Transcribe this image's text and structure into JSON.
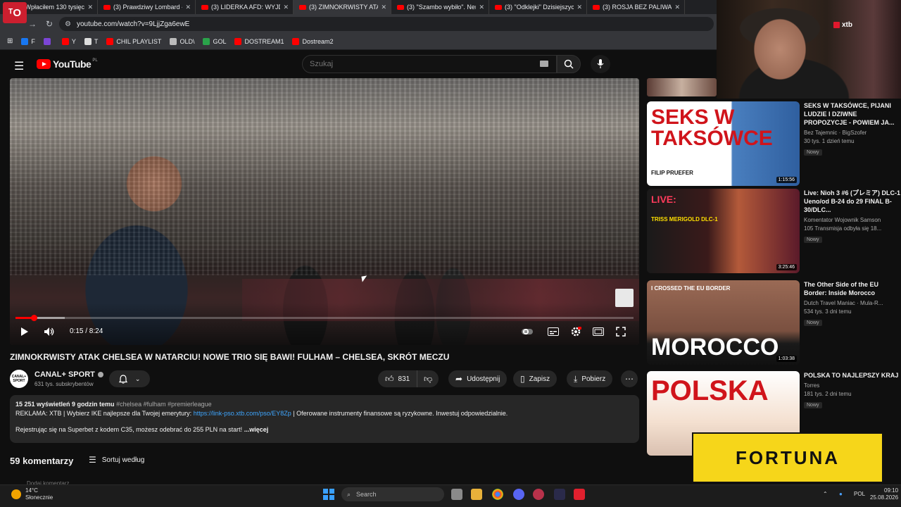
{
  "browser": {
    "tabs": [
      {
        "title": "(3) Wpłaciłem 130 tysięcy",
        "active": false
      },
      {
        "title": "(3) Prawdziwy Lombard -",
        "active": false
      },
      {
        "title": "(3) LIDERKA AFD: WYJDZIE",
        "active": false
      },
      {
        "title": "(3) ZIMNOKRWISTY ATAK",
        "active": true
      },
      {
        "title": "(3) \"Szambo wybiło\". Ner",
        "active": false
      },
      {
        "title": "(3) \"Odklejki\" Dzisiejszych",
        "active": false
      },
      {
        "title": "(3) ROSJA BEZ PALIWA, P",
        "active": false
      }
    ],
    "url": "youtube.com/watch?v=9LjjZga6ewE",
    "bookmarks": [
      {
        "label": "F",
        "color": "#1877f2"
      },
      {
        "label": "",
        "color": "#7b45d6"
      },
      {
        "label": "Y",
        "color": "#ff0000"
      },
      {
        "label": "T",
        "color": "#dddddd"
      },
      {
        "label": "CHIL PLAYLIST",
        "color": "#ff0000"
      },
      {
        "label": "OLD\\",
        "color": "#bbbbbb"
      },
      {
        "label": "GOL",
        "color": "#2aa34a"
      },
      {
        "label": "DOSTREAM1",
        "color": "#ff0000"
      },
      {
        "label": "Dostream2",
        "color": "#ff0000"
      }
    ],
    "favicon_text": "ᵀO"
  },
  "youtube": {
    "logo_text": "YouTube",
    "region": "PL",
    "search_placeholder": "Szukaj"
  },
  "player": {
    "current_time": "0:15",
    "duration": "8:24",
    "time_display": "0:15 / 8:24",
    "progress_fraction": 0.0298,
    "buffer_fraction": 0.08
  },
  "video": {
    "title": "ZIMNOKRWISTY ATAK CHELSEA W NATARCIU! NOWE TRIO SIĘ BAWI! FULHAM – CHELSEA, SKRÓT MECZU",
    "channel": "CANAL+ SPORT",
    "channel_avatar_text": "CANAL+ SPORT",
    "subscribers": "631 tys. subskrybentów",
    "likes": "831",
    "share_label": "Udostępnij",
    "save_label": "Zapisz",
    "download_label": "Pobierz"
  },
  "description": {
    "views_time": "15 251 wyświetleń  9 godzin temu",
    "hashtags": "#chelsea #fulham #premierleague",
    "ad_prefix": "REKLAMA: XTB | Wybierz IKE najlepsze dla Twojej emerytury: ",
    "ad_link": "https://link-pso.xtb.com/pso/EY8Zp",
    "ad_suffix": " | Oferowane instrumenty finansowe są ryzykowne. Inwestuj odpowiedzialnie.",
    "line3": "Rejestrując się na Superbet z kodem C35, możesz odebrać do 255 PLN na start!",
    "more": "...więcej"
  },
  "comments": {
    "count_label": "59 komentarzy",
    "sort_label": "Sortuj według",
    "add_placeholder": "Dodaj komentarz..."
  },
  "sidebar": {
    "items": [
      {
        "title": "SEKS W TAKSÓWCE, PIJANI LUDZIE I DZIWNE PROPOZYCJE - POWIEM JA...",
        "channel": "Bez Tajemnic  ·  BigSzofer",
        "stats": "30 tys.  1 dzień temu",
        "badge": "Nowy",
        "duration": "1:15:56",
        "thumb_text": "SEKS W TAKSÓWCE",
        "thumb_sub": "FILIP PRUEFER"
      },
      {
        "title": "Live: Nioh 3 #6 (プレミア) DLC-1 Ueno/od B-24 do 29 FINAL B-30/DLC...",
        "channel": "Komentator Wojownik Samson",
        "stats": "105  Transmisja odbyła się 18...",
        "badge": "Nowy",
        "duration": "3:25:46",
        "thumb_text": "LIVE:",
        "thumb_sub": "TRISS MERIGOLD DLC-1"
      },
      {
        "title": "The Other Side of the EU Border: Inside Morocco",
        "channel": "Dutch Travel Maniac  ·  Mula-R...",
        "stats": "534 tys.  3 dni temu",
        "badge": "Nowy",
        "duration": "1:03:38",
        "thumb_text": "MOROCCO",
        "thumb_sub": "I CROSSED THE EU BORDER"
      },
      {
        "title": "POLSKA TO NAJLEPSZY KRAJ",
        "channel": "Torres",
        "stats": "181 tys.  2 dni temu",
        "badge": "Nowy",
        "duration": "",
        "thumb_text": "POLSKA",
        "thumb_sub": ""
      }
    ]
  },
  "overlays": {
    "xtb": "xtb",
    "fortuna": "FORTUNA"
  },
  "taskbar": {
    "temperature": "14°C",
    "weather": "Słonecznie",
    "search_placeholder": "Search",
    "language": "POL",
    "time": "09:10",
    "date": "25.08.2026"
  }
}
